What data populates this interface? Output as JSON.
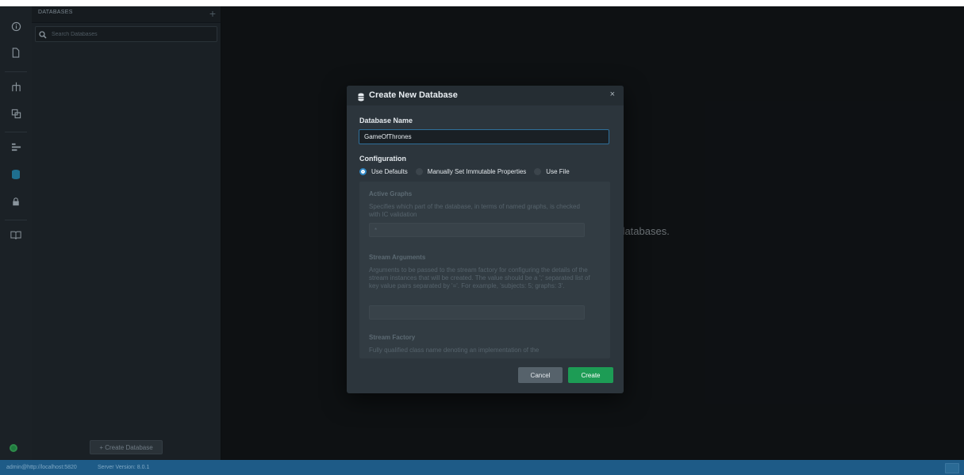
{
  "sidebar": {
    "title": "DATABASES",
    "add_icon": "+",
    "search_placeholder": "Search Databases",
    "create_button_label": "+ Create Database"
  },
  "main": {
    "message": "ntly have any databases."
  },
  "status_bar": {
    "user": "admin@http://localhost:5820",
    "version": "Server Version: 8.0.1"
  },
  "modal": {
    "title": "Create New Database",
    "close_label": "×",
    "name_label": "Database Name",
    "name_value": "GameOfThrones",
    "config_label": "Configuration",
    "options": [
      {
        "label": "Use Defaults",
        "checked": true
      },
      {
        "label": "Manually Set Immutable Properties",
        "checked": false
      },
      {
        "label": "Use File",
        "checked": false
      }
    ],
    "properties": [
      {
        "title": "Active Graphs",
        "description": "Specifies which part of the database, in terms of named graphs, is checked with IC validation",
        "value": "*"
      },
      {
        "title": "Stream Arguments",
        "description": "Arguments to be passed to the stream factory for configuring the details of the stream instances that will be created. The value should be a ';' separated list of key value pairs separated by '='. For example, 'subjects: 5; graphs: 3'.",
        "value": ""
      },
      {
        "title": "Stream Factory",
        "description": "Fully qualified class name denoting an implementation of the",
        "value": ""
      }
    ],
    "cancel_label": "Cancel",
    "create_label": "Create"
  },
  "colors": {
    "accent": "#2f87c5",
    "primary_button": "#1d9c55",
    "status_bar": "#1e5b87"
  }
}
